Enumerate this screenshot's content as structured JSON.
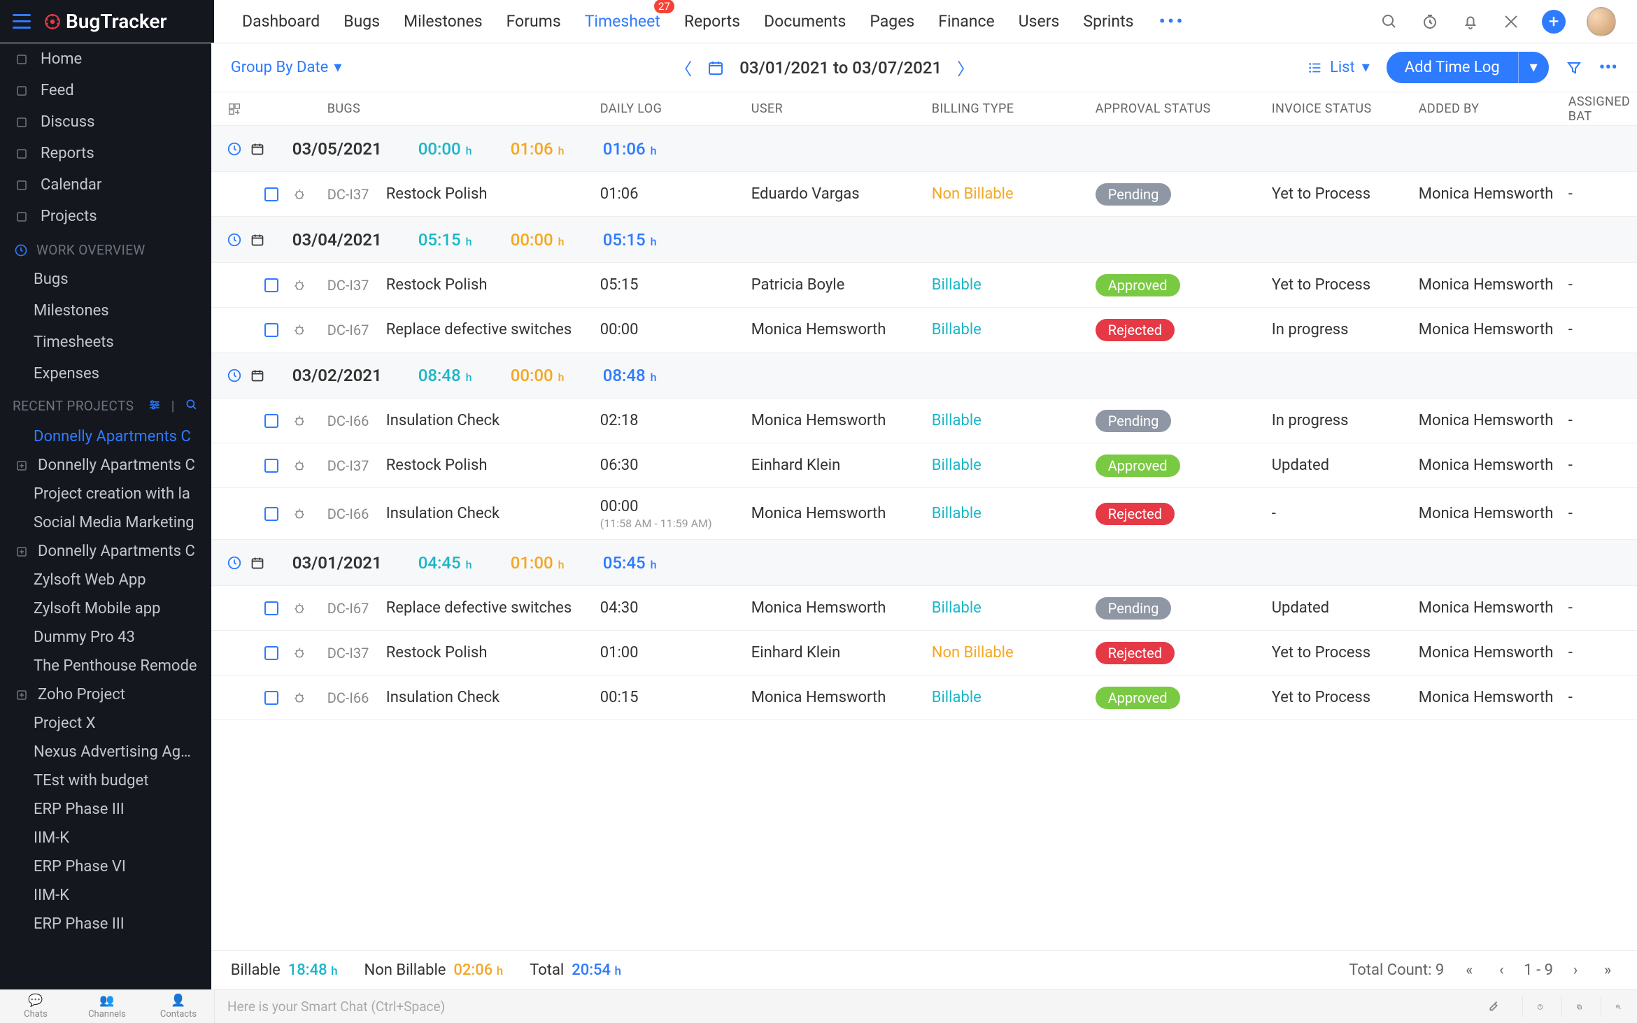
{
  "brand": {
    "name": "BugTracker"
  },
  "topnav": {
    "items": [
      "Dashboard",
      "Bugs",
      "Milestones",
      "Forums",
      "Timesheet",
      "Reports",
      "Documents",
      "Pages",
      "Finance",
      "Users",
      "Sprints"
    ],
    "active_index": 4,
    "badge_on_index": 4,
    "badge_value": "27"
  },
  "sidebar": {
    "nav": [
      "Home",
      "Feed",
      "Discuss",
      "Reports",
      "Calendar",
      "Projects"
    ],
    "section1": "WORK OVERVIEW",
    "work_overview": [
      "Bugs",
      "Milestones",
      "Timesheets",
      "Expenses"
    ],
    "section2": "RECENT PROJECTS",
    "projects": [
      {
        "name": "Donnelly Apartments C",
        "active": true,
        "hasfolder": false
      },
      {
        "name": "Donnelly Apartments C",
        "hasfolder": true
      },
      {
        "name": "Project creation with la",
        "hasfolder": false
      },
      {
        "name": "Social Media Marketing",
        "hasfolder": false
      },
      {
        "name": "Donnelly Apartments C",
        "hasfolder": true
      },
      {
        "name": "Zylsoft Web App",
        "hasfolder": false
      },
      {
        "name": "Zylsoft Mobile app",
        "hasfolder": false
      },
      {
        "name": "Dummy Pro 43",
        "hasfolder": false
      },
      {
        "name": "The Penthouse Remode",
        "hasfolder": false
      },
      {
        "name": "Zoho Project",
        "hasfolder": true
      },
      {
        "name": "Project X",
        "hasfolder": false
      },
      {
        "name": "Nexus Advertising Agen",
        "hasfolder": false
      },
      {
        "name": "TEst with budget",
        "hasfolder": false
      },
      {
        "name": "ERP Phase III",
        "hasfolder": false
      },
      {
        "name": "IIM-K",
        "hasfolder": false
      },
      {
        "name": "ERP Phase VI",
        "hasfolder": false
      },
      {
        "name": "IIM-K",
        "hasfolder": false
      },
      {
        "name": "ERP Phase III",
        "hasfolder": false
      }
    ]
  },
  "toolbar": {
    "group_by": "Group By Date",
    "date_range": "03/01/2021 to 03/07/2021",
    "view_label": "List",
    "add_button": "Add Time Log"
  },
  "columns": [
    "BUGS",
    "DAILY LOG",
    "USER",
    "BILLING TYPE",
    "APPROVAL STATUS",
    "INVOICE STATUS",
    "ADDED BY",
    "ASSIGNED BAT"
  ],
  "groups": [
    {
      "date": "03/05/2021",
      "billable": "00:00",
      "nonbillable": "01:06",
      "total": "01:06",
      "rows": [
        {
          "bug_id": "DC-I37",
          "bug_name": "Restock Polish",
          "daily": "01:06",
          "user": "Eduardo Vargas",
          "billing": "Non Billable",
          "approval": "Pending",
          "invoice": "Yet to Process",
          "added": "Monica Hemsworth",
          "batch": "-"
        }
      ]
    },
    {
      "date": "03/04/2021",
      "billable": "05:15",
      "nonbillable": "00:00",
      "total": "05:15",
      "rows": [
        {
          "bug_id": "DC-I37",
          "bug_name": "Restock Polish",
          "daily": "05:15",
          "user": "Patricia Boyle",
          "billing": "Billable",
          "approval": "Approved",
          "invoice": "Yet to Process",
          "added": "Monica Hemsworth",
          "batch": "-"
        },
        {
          "bug_id": "DC-I67",
          "bug_name": "Replace defective switches",
          "daily": "00:00",
          "user": "Monica Hemsworth",
          "billing": "Billable",
          "approval": "Rejected",
          "invoice": "In progress",
          "added": "Monica Hemsworth",
          "batch": "-"
        }
      ]
    },
    {
      "date": "03/02/2021",
      "billable": "08:48",
      "nonbillable": "00:00",
      "total": "08:48",
      "rows": [
        {
          "bug_id": "DC-I66",
          "bug_name": "Insulation Check",
          "daily": "02:18",
          "user": "Monica Hemsworth",
          "billing": "Billable",
          "approval": "Pending",
          "invoice": "In progress",
          "added": "Monica Hemsworth",
          "batch": "-"
        },
        {
          "bug_id": "DC-I37",
          "bug_name": "Restock Polish",
          "daily": "06:30",
          "user": "Einhard Klein",
          "billing": "Billable",
          "approval": "Approved",
          "invoice": "Updated",
          "added": "Monica Hemsworth",
          "batch": "-"
        },
        {
          "bug_id": "DC-I66",
          "bug_name": "Insulation Check",
          "daily": "00:00",
          "daily_sub": "(11:58 AM - 11:59 AM)",
          "user": "Monica Hemsworth",
          "billing": "Billable",
          "approval": "Rejected",
          "invoice": "-",
          "added": "Monica Hemsworth",
          "batch": "-"
        }
      ]
    },
    {
      "date": "03/01/2021",
      "billable": "04:45",
      "nonbillable": "01:00",
      "total": "05:45",
      "rows": [
        {
          "bug_id": "DC-I67",
          "bug_name": "Replace defective switches",
          "daily": "04:30",
          "user": "Monica Hemsworth",
          "billing": "Billable",
          "approval": "Pending",
          "invoice": "Updated",
          "added": "Monica Hemsworth",
          "batch": "-"
        },
        {
          "bug_id": "DC-I37",
          "bug_name": "Restock Polish",
          "daily": "01:00",
          "user": "Einhard Klein",
          "billing": "Non Billable",
          "approval": "Rejected",
          "invoice": "Yet to Process",
          "added": "Monica Hemsworth",
          "batch": "-"
        },
        {
          "bug_id": "DC-I66",
          "bug_name": "Insulation Check",
          "daily": "00:15",
          "user": "Monica Hemsworth",
          "billing": "Billable",
          "approval": "Approved",
          "invoice": "Yet to Process",
          "added": "Monica Hemsworth",
          "batch": "-"
        }
      ]
    }
  ],
  "footer": {
    "billable_label": "Billable",
    "billable_value": "18:48",
    "nonbillable_label": "Non Billable",
    "nonbillable_value": "02:06",
    "total_label": "Total",
    "total_value": "20:54",
    "count_label": "Total Count: 9",
    "page_range": "1 - 9"
  },
  "chatbar": {
    "tabs": [
      "Chats",
      "Channels",
      "Contacts"
    ],
    "placeholder": "Here is your Smart Chat (Ctrl+Space)"
  }
}
